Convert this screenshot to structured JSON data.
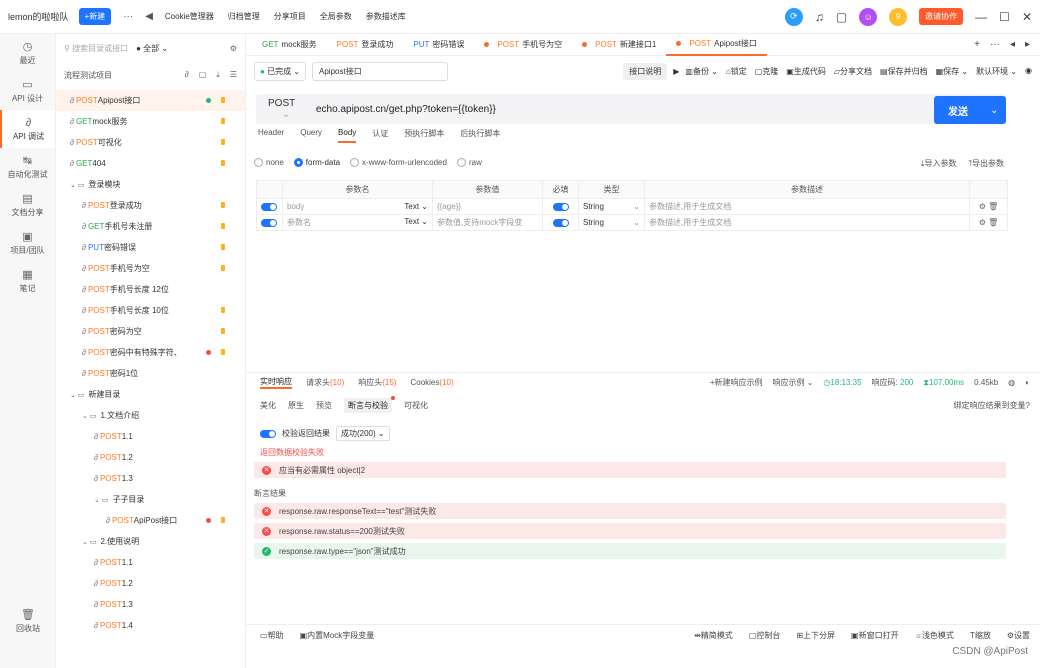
{
  "titlebar": {
    "team": "lemon的啦啦队",
    "new_label": "+新建",
    "menu": [
      "Cookie管理器",
      "归档管理",
      "分享项目",
      "全局参数",
      "参数描述库"
    ],
    "badge_count": "9",
    "invite_label": "邀请协作"
  },
  "rail": {
    "items": [
      "最近",
      "API 设计",
      "API 调试",
      "自动化测试",
      "文档分享",
      "项目/团队",
      "笔记"
    ],
    "bottom": "回收站"
  },
  "tree": {
    "search_placeholder": "搜索目录或接口",
    "filter": "全部",
    "head_label": "流程测试项目",
    "rows": [
      {
        "m": "POST",
        "name": "Apipost接口",
        "level": 0
      },
      {
        "m": "GET",
        "name": "mock服务",
        "level": 0
      },
      {
        "m": "POST",
        "name": "可视化",
        "level": 0
      },
      {
        "m": "GET",
        "name": "404",
        "level": 0
      },
      {
        "m": "",
        "name": "登录模块",
        "level": 0
      },
      {
        "m": "POST",
        "name": "登录成功",
        "level": 1
      },
      {
        "m": "GET",
        "name": "手机号未注册",
        "level": 1
      },
      {
        "m": "PUT",
        "name": "密码错误",
        "level": 1
      },
      {
        "m": "POST",
        "name": "手机号为空",
        "level": 1
      },
      {
        "m": "POST",
        "name": "手机号长度 12位",
        "level": 1
      },
      {
        "m": "POST",
        "name": "手机号长度 10位",
        "level": 1
      },
      {
        "m": "POST",
        "name": "密码为空",
        "level": 1
      },
      {
        "m": "POST",
        "name": "密码中有特殊字符、",
        "level": 1
      },
      {
        "m": "POST",
        "name": "密码1位",
        "level": 1
      },
      {
        "m": "",
        "name": "新建目录",
        "level": 0
      },
      {
        "m": "",
        "name": "1.文档介绍",
        "level": 1
      },
      {
        "m": "POST",
        "name": "1.1",
        "level": 2
      },
      {
        "m": "POST",
        "name": "1.2",
        "level": 2
      },
      {
        "m": "POST",
        "name": "1.3",
        "level": 2
      },
      {
        "m": "",
        "name": "子子目录",
        "level": 2
      },
      {
        "m": "POST",
        "name": "ApiPost接口",
        "level": 3
      },
      {
        "m": "",
        "name": "2.使用说明",
        "level": 1
      },
      {
        "m": "POST",
        "name": "1.1",
        "level": 2
      },
      {
        "m": "POST",
        "name": "1.2",
        "level": 2
      },
      {
        "m": "POST",
        "name": "1.3",
        "level": 2
      },
      {
        "m": "POST",
        "name": "1.4",
        "level": 2
      }
    ]
  },
  "tabs": [
    {
      "m": "GET",
      "name": "mock服务"
    },
    {
      "m": "POST",
      "name": "登录成功"
    },
    {
      "m": "PUT",
      "name": "密码错误"
    },
    {
      "m": "POST",
      "name": "手机号为空"
    },
    {
      "m": "POST",
      "name": "新建接口1"
    },
    {
      "m": "POST",
      "name": "Apipost接口"
    }
  ],
  "request": {
    "status": "已完成",
    "name": "Apipost接口",
    "desc_btn": "接口说明",
    "tools": [
      "备份",
      "锁定",
      "克隆",
      "生成代码",
      "分享文档",
      "保存并归档",
      "保存"
    ],
    "env": "默认环境",
    "method": "POST",
    "url": "echo.apipost.cn/get.php?token={{token}}",
    "send": "发送",
    "tabs": [
      "Header",
      "Query",
      "Body",
      "认证",
      "预执行脚本",
      "后执行脚本"
    ],
    "body_types": [
      "none",
      "form-data",
      "x-www-form-urlencoded",
      "raw"
    ],
    "import": "导入参数",
    "export": "导出参数",
    "headers": [
      "参数名",
      "参数值",
      "必填",
      "类型",
      "参数描述"
    ],
    "params": [
      {
        "name": "body",
        "ptype": "Text",
        "value": "{{age}}",
        "type": "String",
        "desc": "参数描述,用于生成文档"
      },
      {
        "name": "参数名",
        "ptype": "Text",
        "value": "参数值,支持mock字段变",
        "type": "String",
        "desc": "参数描述,用于生成文档"
      }
    ]
  },
  "response": {
    "tabs": [
      {
        "label": "实时响应",
        "count": ""
      },
      {
        "label": "请求头",
        "count": "(10)"
      },
      {
        "label": "响应头",
        "count": "(15)"
      },
      {
        "label": "Cookies",
        "count": "(10)"
      }
    ],
    "new_example": "+新建响应示例",
    "example": "响应示例",
    "time": "18:13:35",
    "code_label": "响应码:",
    "code": "200",
    "duration": "107.00ms",
    "size": "0.45kb",
    "sub_tabs": [
      "美化",
      "原生",
      "预览",
      "断言与校验",
      "可视化"
    ],
    "bind": "绑定响应结果到变量?",
    "verify_label": "校验返回结果",
    "verify_value": "成功(200)",
    "verify_fail": "返回数据校验失败",
    "fail_item": "应当有必需属性 object|2",
    "assert_title": "断言结果",
    "asserts": [
      {
        "ok": false,
        "text": "response.raw.responseText==\"test\"测试失败"
      },
      {
        "ok": false,
        "text": "response.raw.status==200测试失败"
      },
      {
        "ok": true,
        "text": "response.raw.type==\"json\"测试成功"
      }
    ]
  },
  "footer": {
    "left": [
      "帮助",
      "内置Mock字段变量"
    ],
    "right": [
      "精简模式",
      "控制台",
      "上下分屏",
      "新窗口打开",
      "浅色模式",
      "缩放",
      "设置"
    ]
  },
  "watermark": "CSDN @ApiPost"
}
